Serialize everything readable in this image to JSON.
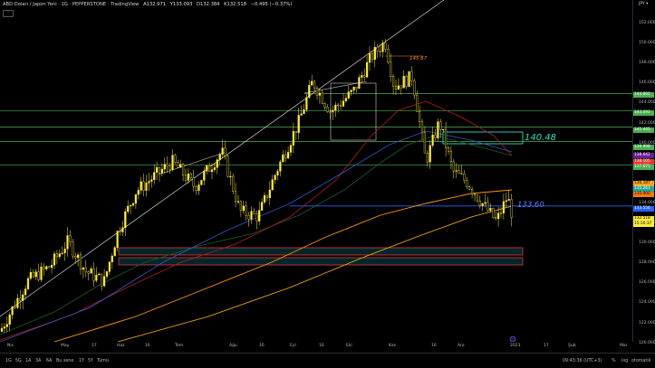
{
  "header": {
    "symbol": "ABD Doları / Japon Yeni · 1G · PEPPERSTONE · TradingView",
    "open": "A132.971",
    "high": "Y133.093",
    "low": "D132.384",
    "close": "K132.518",
    "change": "−0.495 (−0.37%)"
  },
  "axis_corner": "JPY ▾",
  "collapse_label": "˅",
  "price_ticks": [
    "152.000",
    "150.000",
    "148.000",
    "146.000",
    "144.000",
    "142.000",
    "140.000",
    "138.000",
    "136.000",
    "134.000",
    "132.000",
    "130.000",
    "128.000",
    "126.000",
    "124.000",
    "122.000",
    "120.000"
  ],
  "price_labels": [
    {
      "text": "144.805",
      "bg": "#4caf50",
      "fg": "#ffffff"
    },
    {
      "text": "143.093",
      "bg": "#4caf50",
      "fg": "#ffffff"
    },
    {
      "text": "141.445",
      "bg": "#4caf50",
      "fg": "#ffffff"
    },
    {
      "text": "139.998",
      "bg": "#4caf50",
      "fg": "#ffffff"
    },
    {
      "text": "138.642",
      "bg": "#6a1b9a",
      "fg": "#ffffff"
    },
    {
      "text": "138.105",
      "bg": "#e53935",
      "fg": "#ffffff"
    },
    {
      "text": "137.675",
      "bg": "#4caf50",
      "fg": "#ffffff"
    },
    {
      "text": "136.187",
      "bg": "#f5a623",
      "fg": "#000000"
    },
    {
      "text": "135.261",
      "bg": "#26a69a",
      "fg": "#ffffff"
    },
    {
      "text": "135.000",
      "bg": "#f57c00",
      "fg": "#000000"
    },
    {
      "text": "133.556",
      "bg": "#2962ff",
      "fg": "#ffffff"
    },
    {
      "text": "132.518",
      "bg": "#ffeb3b",
      "fg": "#000000"
    },
    {
      "text": "15:10:37",
      "bg": "#ffeb3b",
      "fg": "#000000"
    }
  ],
  "time_ticks": [
    "Nis",
    "May",
    "17",
    "Haz",
    "16",
    "Tem",
    "Ağu",
    "16",
    "Eyl",
    "16",
    "Eki",
    "Kas",
    "16",
    "Ara",
    "2023",
    "17",
    "Şub",
    "Mar"
  ],
  "timeframes": [
    "1G",
    "5G",
    "1A",
    "3A",
    "6A",
    "Bu sene",
    "1Y",
    "5Y",
    "Tümü"
  ],
  "bottom_right": {
    "time": "09:43:36 (UTC+3)",
    "percent": "%",
    "log": "log",
    "auto": "otomatik"
  },
  "annotations": {
    "high": "145.67",
    "resist": "140.48",
    "support": "133.60"
  },
  "colors": {
    "candle": "#ffeb3b",
    "hline": "#4caf50",
    "ma_green": "#1b5e20",
    "ma_red": "#b71c1c",
    "ma_blue": "#1e3a8a",
    "ma_orange": "#ff9800",
    "ma_yellow": "#ffb300",
    "zone": "#e53935",
    "trend": "#cfcfcf",
    "teal": "#26e0c8",
    "blue": "#2962ff"
  }
}
